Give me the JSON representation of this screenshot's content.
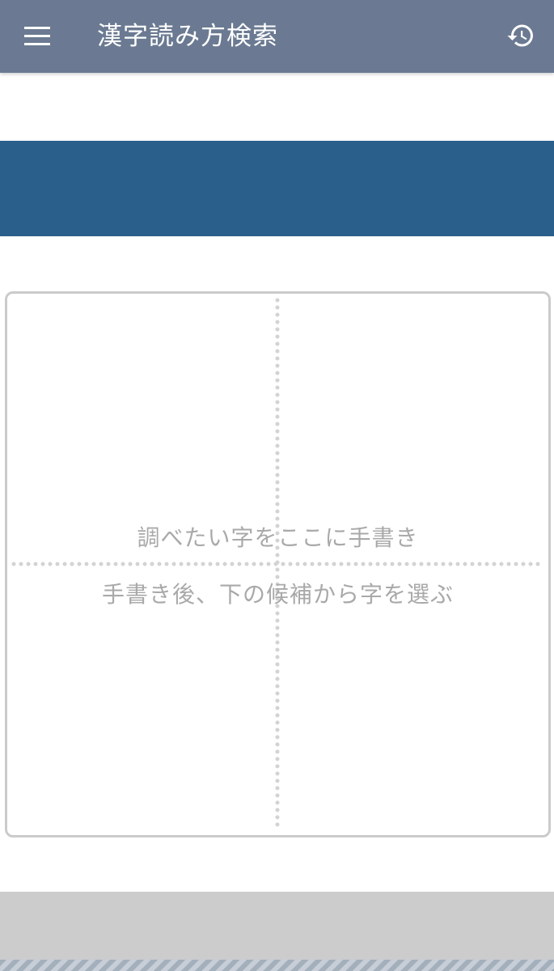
{
  "app_bar": {
    "title": "漢字読み方検索",
    "menu_icon": "menu-icon",
    "history_icon": "history-icon",
    "background": "#6b7a92"
  },
  "banner": {
    "color": "#2a5f8b"
  },
  "handwriting": {
    "hint_line1": "調べたい字をここに手書き",
    "hint_line2": "手書き後、下の候補から字を選ぶ",
    "hint_color": "#a9a9a9",
    "border_color": "#cbcbcb"
  },
  "candidates": {
    "background": "#cccccc"
  }
}
